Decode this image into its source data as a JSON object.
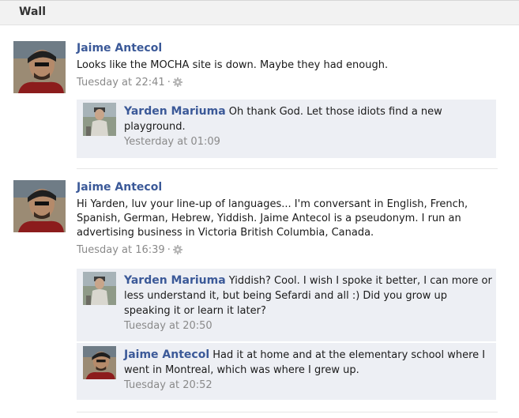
{
  "header": {
    "title": "Wall"
  },
  "posts": [
    {
      "author": "Jaime Antecol",
      "message": "Looks like the MOCHA site is down. Maybe they had enough.",
      "time": "Tuesday at 22:41",
      "comments": [
        {
          "author": "Yarden Mariuma",
          "text": "Oh thank God. Let those idiots find a new playground.",
          "time": "Yesterday at 01:09"
        }
      ]
    },
    {
      "author": "Jaime Antecol",
      "message": "Hi Yarden, luv your line-up of languages... I'm conversant in English, French, Spanish, German, Hebrew, Yiddish. Jaime Antecol is a pseudonym. I run an advertising business in Victoria British Columbia, Canada.",
      "time": "Tuesday at 16:39",
      "comments": [
        {
          "author": "Yarden Mariuma",
          "text": "Yiddish? Cool. I wish I spoke it better, I can more or less understand it, but being Sefardi and all :) Did you grow up speaking it or learn it later?",
          "time": "Tuesday at 20:50"
        },
        {
          "author": "Jaime Antecol",
          "text": "Had it at home and at the elementary school where I went in Montreal, which was where I grew up.",
          "time": "Tuesday at 20:52"
        }
      ]
    }
  ],
  "icons": {
    "gear": "gear-icon",
    "separator": "·"
  },
  "colors": {
    "link": "#3b5998",
    "comment_bg": "#edeff4",
    "meta": "#8a8a8a"
  }
}
